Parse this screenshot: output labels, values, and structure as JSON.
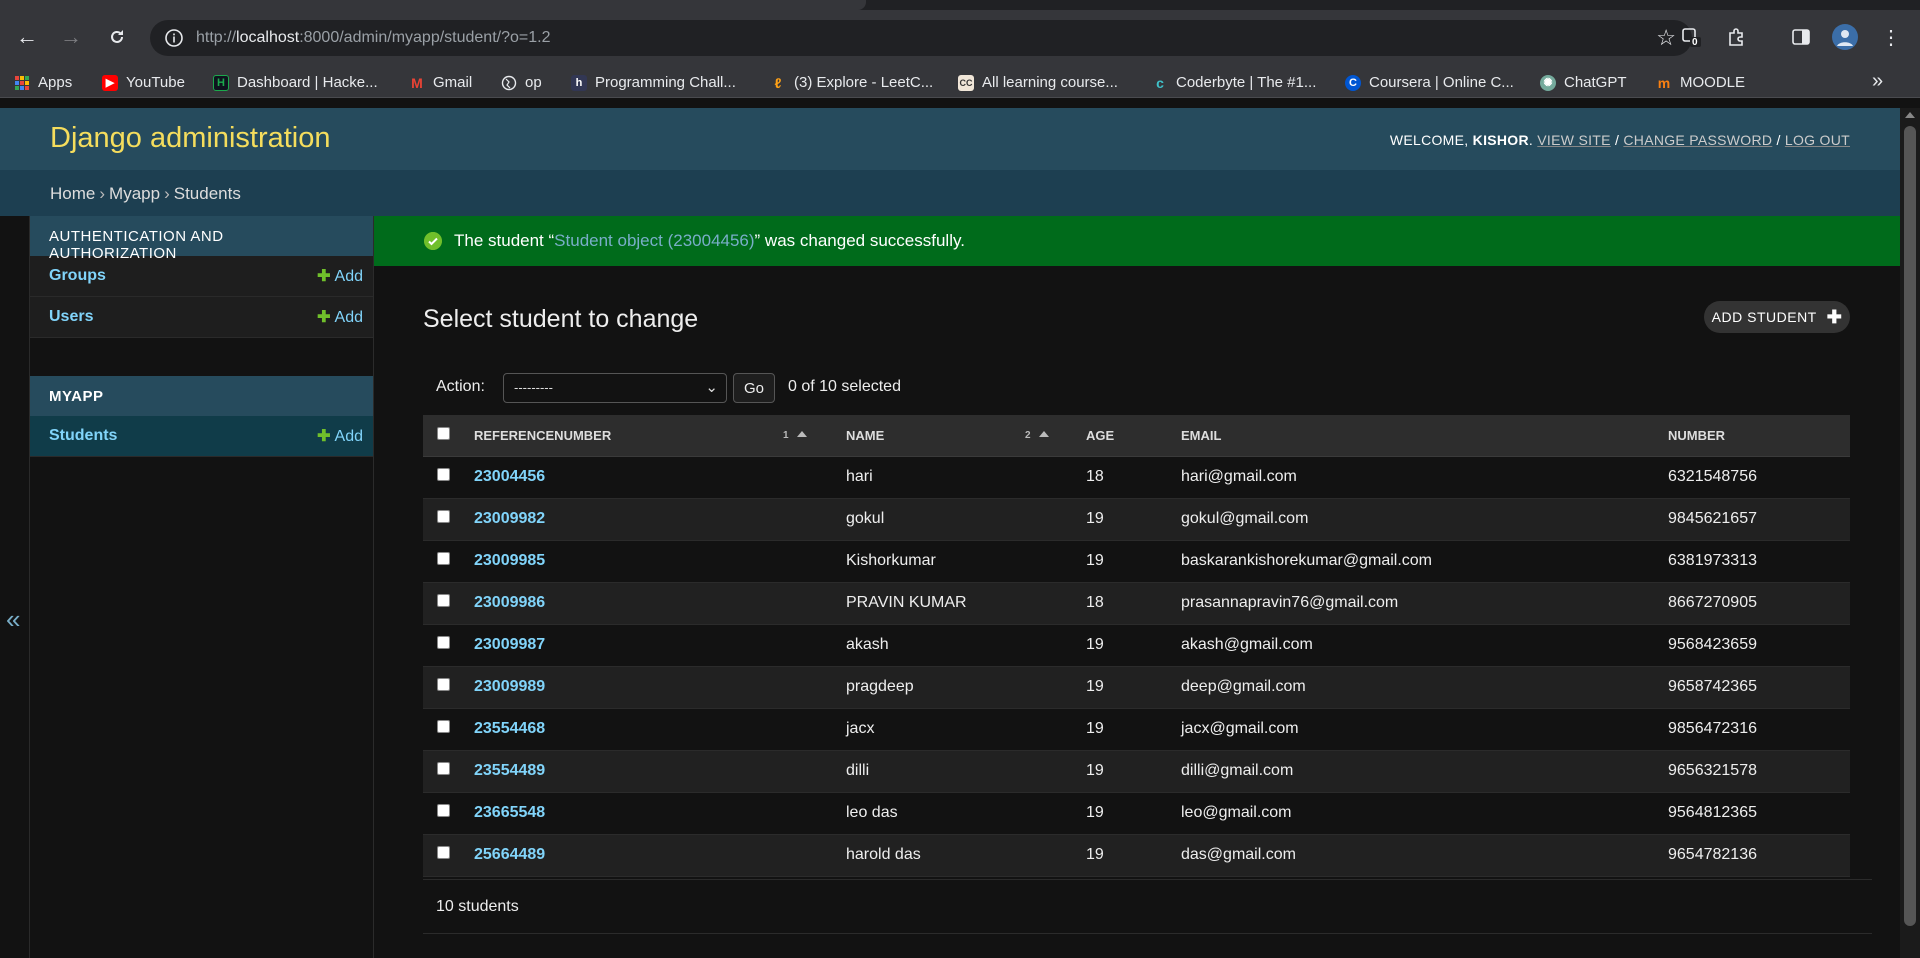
{
  "browser": {
    "url_prefix": "http://",
    "url_host": "localhost",
    "url_rest": ":8000/admin/myapp/student/?o=1.2",
    "extension_badge": "0",
    "bookmarks": [
      {
        "label": "Apps",
        "icon": "apps-grid-icon",
        "color": "#e8453c"
      },
      {
        "label": "YouTube",
        "icon": "youtube-icon",
        "color": "#ff0000"
      },
      {
        "label": "Dashboard | Hacke...",
        "icon": "hackerrank-icon",
        "color": "#1ba94c"
      },
      {
        "label": "Gmail",
        "icon": "gmail-icon",
        "color": "#ea4335"
      },
      {
        "label": "op",
        "icon": "globe-icon",
        "color": "#9aa0a6"
      },
      {
        "label": "Programming Chall...",
        "icon": "hackerearth-icon",
        "color": "#323754"
      },
      {
        "label": "(3) Explore - LeetC...",
        "icon": "leetcode-icon",
        "color": "#ffa116"
      },
      {
        "label": "All learning course...",
        "icon": "codecademy-icon",
        "color": "#f0e6d8"
      },
      {
        "label": "Coderbyte | The #1...",
        "icon": "coderbyte-icon",
        "color": "#3fc1c9"
      },
      {
        "label": "Coursera | Online C...",
        "icon": "coursera-icon",
        "color": "#0056d2"
      },
      {
        "label": "ChatGPT",
        "icon": "chatgpt-icon",
        "color": "#74aa9c"
      },
      {
        "label": "MOODLE",
        "icon": "moodle-icon",
        "color": "#f98012"
      }
    ],
    "more_bookmarks": "»"
  },
  "header": {
    "brand": "Django administration",
    "welcome": "WELCOME, ",
    "username": "KISHOR",
    "view_site": "VIEW SITE",
    "change_password": "CHANGE PASSWORD",
    "log_out": "LOG OUT"
  },
  "breadcrumbs": [
    "Home",
    "Myapp",
    "Students"
  ],
  "sidebar": {
    "toggle": "«",
    "modules": [
      {
        "caption": "AUTHENTICATION AND AUTHORIZATION",
        "models": [
          {
            "name": "Groups",
            "add": "Add"
          },
          {
            "name": "Users",
            "add": "Add"
          }
        ]
      },
      {
        "caption": "MYAPP",
        "models": [
          {
            "name": "Students",
            "add": "Add"
          }
        ]
      }
    ]
  },
  "message": {
    "before": "The student “",
    "link": "Student object (23004456)",
    "after": "” was changed successfully."
  },
  "page": {
    "title": "Select student to change",
    "add_button": "ADD STUDENT"
  },
  "actions": {
    "label": "Action:",
    "selected": "---------",
    "go": "Go",
    "counter": "0 of 10 selected"
  },
  "table": {
    "headers": {
      "ref": "REFERENCENUMBER",
      "ref_sort": "1",
      "name": "NAME",
      "name_sort": "2",
      "age": "AGE",
      "email": "EMAIL",
      "number": "NUMBER"
    },
    "rows": [
      {
        "ref": "23004456",
        "name": "hari",
        "age": "18",
        "email": "hari@gmail.com",
        "number": "6321548756"
      },
      {
        "ref": "23009982",
        "name": "gokul",
        "age": "19",
        "email": "gokul@gmail.com",
        "number": "9845621657"
      },
      {
        "ref": "23009985",
        "name": "Kishorkumar",
        "age": "19",
        "email": "baskarankishorekumar@gmail.com",
        "number": "6381973313"
      },
      {
        "ref": "23009986",
        "name": "PRAVIN KUMAR",
        "age": "18",
        "email": "prasannapravin76@gmail.com",
        "number": "8667270905"
      },
      {
        "ref": "23009987",
        "name": "akash",
        "age": "19",
        "email": "akash@gmail.com",
        "number": "9568423659"
      },
      {
        "ref": "23009989",
        "name": "pragdeep",
        "age": "19",
        "email": "deep@gmail.com",
        "number": "9658742365"
      },
      {
        "ref": "23554468",
        "name": "jacx",
        "age": "19",
        "email": "jacx@gmail.com",
        "number": "9856472316"
      },
      {
        "ref": "23554489",
        "name": "dilli",
        "age": "19",
        "email": "dilli@gmail.com",
        "number": "9656321578"
      },
      {
        "ref": "23665548",
        "name": "leo das",
        "age": "19",
        "email": "leo@gmail.com",
        "number": "9564812365"
      },
      {
        "ref": "25664489",
        "name": "harold das",
        "age": "19",
        "email": "das@gmail.com",
        "number": "9654782136"
      }
    ]
  },
  "paginator": "10 students",
  "colors": {
    "header_bg": "#264b5d",
    "brand": "#f5dd5d",
    "link": "#81d4fa",
    "success_bg": "#006b1b",
    "add_plus": "#70bf2b"
  }
}
